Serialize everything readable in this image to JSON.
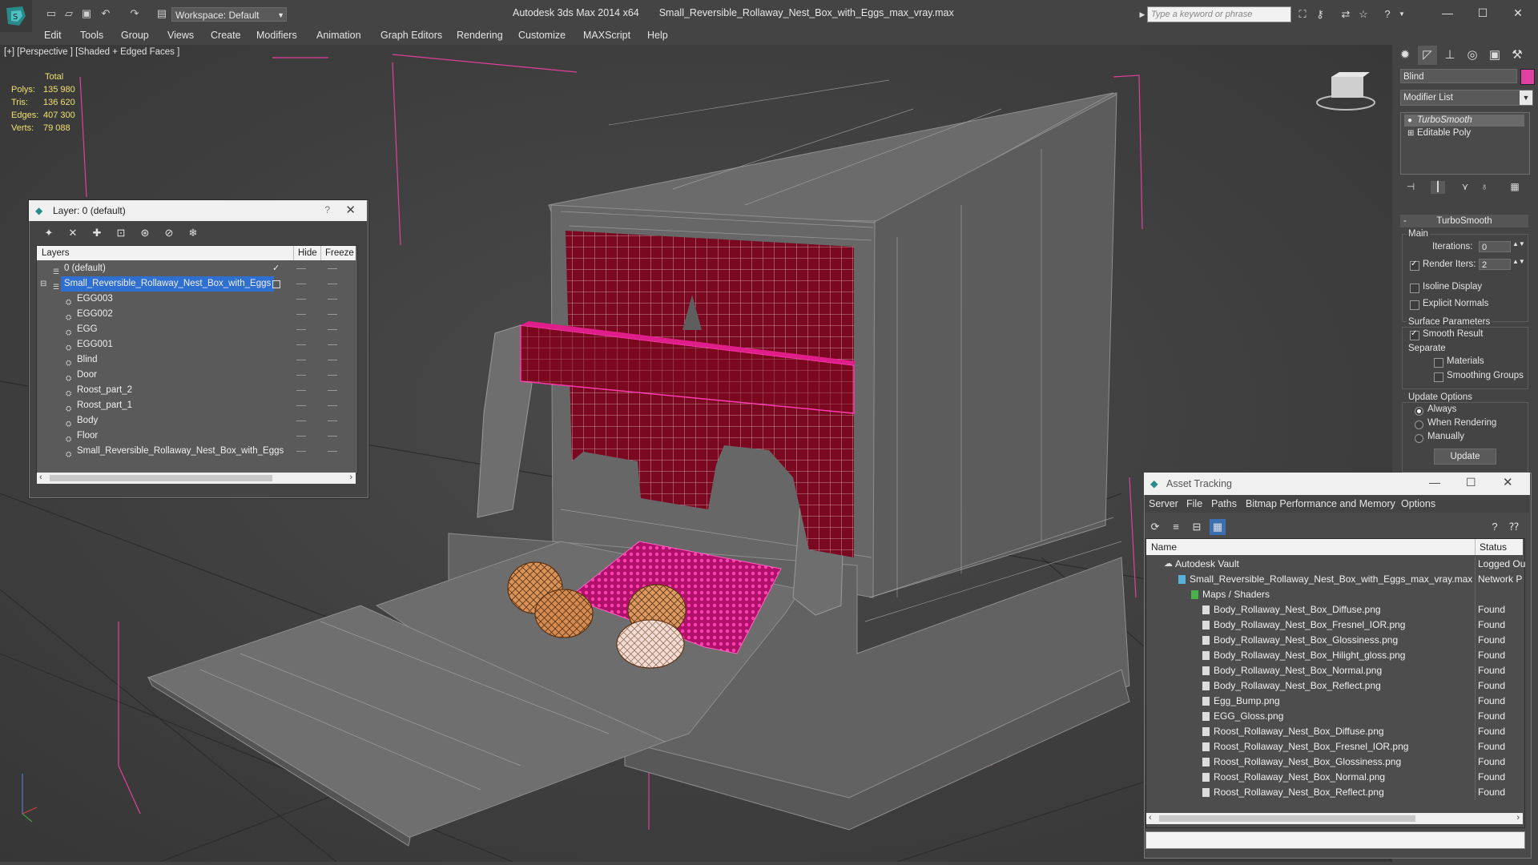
{
  "app": {
    "title": "Autodesk 3ds Max  2014 x64",
    "file": "Small_Reversible_Rollaway_Nest_Box_with_Eggs_max_vray.max",
    "workspace": "Workspace: Default",
    "search_placeholder": "Type a keyword or phrase"
  },
  "menu": [
    "Edit",
    "Tools",
    "Group",
    "Views",
    "Create",
    "Modifiers",
    "Animation",
    "Graph Editors",
    "Rendering",
    "Customize",
    "MAXScript",
    "Help"
  ],
  "viewport": {
    "label": "[+] [Perspective ] [Shaded + Edged Faces ]",
    "stats": {
      "header": "Total",
      "rows": [
        {
          "k": "Polys:",
          "v": "135 980"
        },
        {
          "k": "Tris:",
          "v": "136 620"
        },
        {
          "k": "Edges:",
          "v": "407 300"
        },
        {
          "k": "Verts:",
          "v": "79 088"
        }
      ]
    }
  },
  "command_panel": {
    "object_name": "Blind",
    "object_color": "#e040a0",
    "modifier_list": "Modifier List",
    "stack": [
      "TurboSmooth",
      "Editable Poly"
    ],
    "rollout": "TurboSmooth",
    "main_label": "Main",
    "iterations_label": "Iterations:",
    "iterations_value": "0",
    "render_iters_label": "Render Iters:",
    "render_iters_value": "2",
    "isoline_label": "Isoline Display",
    "explicit_normals_label": "Explicit Normals",
    "surface_params_label": "Surface Parameters",
    "smooth_result_label": "Smooth Result",
    "separate_label": "Separate",
    "materials_label": "Materials",
    "smoothing_groups_label": "Smoothing Groups",
    "update_options_label": "Update Options",
    "always_label": "Always",
    "when_rendering_label": "When Rendering",
    "manually_label": "Manually",
    "update_button": "Update"
  },
  "layer_dialog": {
    "title": "Layer: 0 (default)",
    "help": "?",
    "col_layers": "Layers",
    "col_hide": "Hide",
    "col_freeze": "Freeze",
    "rows": [
      {
        "name": "0 (default)",
        "level": 0
      },
      {
        "name": "Small_Reversible_Rollaway_Nest_Box_with_Eggs",
        "level": 0
      },
      {
        "name": "EGG003",
        "level": 1
      },
      {
        "name": "EGG002",
        "level": 1
      },
      {
        "name": "EGG",
        "level": 1
      },
      {
        "name": "EGG001",
        "level": 1
      },
      {
        "name": "Blind",
        "level": 1
      },
      {
        "name": "Door",
        "level": 1
      },
      {
        "name": "Roost_part_2",
        "level": 1
      },
      {
        "name": "Roost_part_1",
        "level": 1
      },
      {
        "name": "Body",
        "level": 1
      },
      {
        "name": "Floor",
        "level": 1
      },
      {
        "name": "Small_Reversible_Rollaway_Nest_Box_with_Eggs",
        "level": 1
      }
    ]
  },
  "asset_tracking": {
    "title": "Asset Tracking",
    "menu": [
      "Server",
      "File",
      "Paths",
      "Bitmap Performance and Memory",
      "Options"
    ],
    "col_name": "Name",
    "col_status": "Status",
    "rows": [
      {
        "name": "Autodesk Vault",
        "status": "Logged Ou",
        "level": 0
      },
      {
        "name": "Small_Reversible_Rollaway_Nest_Box_with_Eggs_max_vray.max",
        "status": "Network P",
        "level": 1
      },
      {
        "name": "Maps / Shaders",
        "status": "",
        "level": 2
      },
      {
        "name": "Body_Rollaway_Nest_Box_Diffuse.png",
        "status": "Found",
        "level": 3
      },
      {
        "name": "Body_Rollaway_Nest_Box_Fresnel_IOR.png",
        "status": "Found",
        "level": 3
      },
      {
        "name": "Body_Rollaway_Nest_Box_Glossiness.png",
        "status": "Found",
        "level": 3
      },
      {
        "name": "Body_Rollaway_Nest_Box_Hilight_gloss.png",
        "status": "Found",
        "level": 3
      },
      {
        "name": "Body_Rollaway_Nest_Box_Normal.png",
        "status": "Found",
        "level": 3
      },
      {
        "name": "Body_Rollaway_Nest_Box_Reflect.png",
        "status": "Found",
        "level": 3
      },
      {
        "name": "Egg_Bump.png",
        "status": "Found",
        "level": 3
      },
      {
        "name": "EGG_Gloss.png",
        "status": "Found",
        "level": 3
      },
      {
        "name": "Roost_Rollaway_Nest_Box_Diffuse.png",
        "status": "Found",
        "level": 3
      },
      {
        "name": "Roost_Rollaway_Nest_Box_Fresnel_IOR.png",
        "status": "Found",
        "level": 3
      },
      {
        "name": "Roost_Rollaway_Nest_Box_Glossiness.png",
        "status": "Found",
        "level": 3
      },
      {
        "name": "Roost_Rollaway_Nest_Box_Normal.png",
        "status": "Found",
        "level": 3
      },
      {
        "name": "Roost_Rollaway_Nest_Box_Reflect.png",
        "status": "Found",
        "level": 3
      }
    ]
  },
  "colors": {
    "accent_selection": "#2f6fd0",
    "selected_object_wire": "#e0168a",
    "stats_text": "#f0e070"
  }
}
